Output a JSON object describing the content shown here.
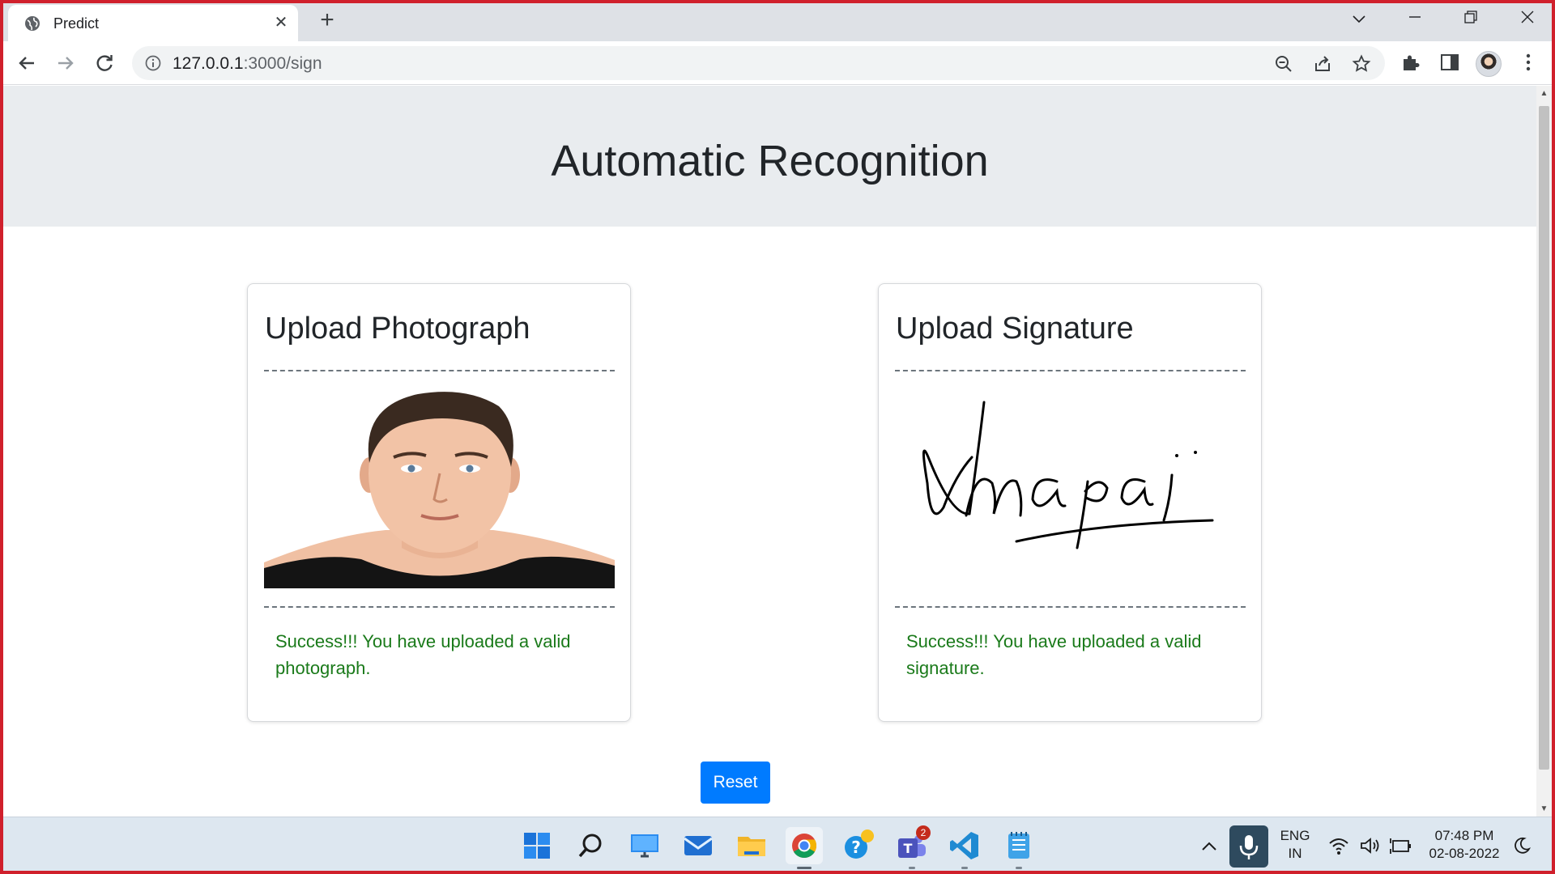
{
  "browser": {
    "tab_title": "Predict",
    "url_host": "127.0.0.1",
    "url_rest": ":3000/sign"
  },
  "page": {
    "title": "Automatic Recognition",
    "photo_card": {
      "title": "Upload Photograph",
      "message": "Success!!! You have uploaded a valid photograph."
    },
    "signature_card": {
      "title": "Upload Signature",
      "message": "Success!!! You have uploaded a valid signature."
    },
    "reset_label": "Reset",
    "colors": {
      "success": "#1a7a1a",
      "primary": "#007bff",
      "header_bg": "#e9ecef"
    }
  },
  "taskbar": {
    "apps": [
      "windows-start",
      "search",
      "desktop",
      "mail",
      "file-explorer",
      "chrome",
      "tips",
      "teams",
      "vscode",
      "notepad"
    ],
    "teams_badge": "2",
    "lang_line1": "ENG",
    "lang_line2": "IN",
    "time": "07:48 PM",
    "date": "02-08-2022"
  }
}
